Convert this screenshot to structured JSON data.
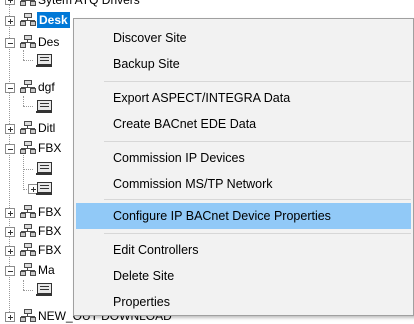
{
  "tree": {
    "nodes": [
      {
        "label": "Sytem ATQ Drivers"
      },
      {
        "label": "Desk",
        "selected": true
      },
      {
        "label": "Des"
      },
      {
        "label": "dgf"
      },
      {
        "label": "Ditl"
      },
      {
        "label": "FBX"
      },
      {
        "label": "FBX"
      },
      {
        "label": "FBX"
      },
      {
        "label": "FBX"
      },
      {
        "label": "Ma"
      },
      {
        "label": "NEW_OUT DOWNLOAD"
      }
    ]
  },
  "context_menu": {
    "highlighted_index": 6,
    "items": [
      {
        "label": "Discover Site"
      },
      {
        "label": "Backup Site"
      },
      {
        "label": "Export ASPECT/INTEGRA Data"
      },
      {
        "label": "Create BACnet EDE Data"
      },
      {
        "label": "Commission IP Devices"
      },
      {
        "label": "Commission MS/TP Network"
      },
      {
        "label": "Configure IP BACnet Device Properties"
      },
      {
        "label": "Edit Controllers"
      },
      {
        "label": "Delete Site"
      },
      {
        "label": "Properties"
      }
    ]
  },
  "colors": {
    "selection": "#0078d7",
    "menu_highlight": "#91c9f7",
    "menu_background": "#f2f2f2"
  },
  "icons": [
    "site-icon",
    "device-icon",
    "expand-icon",
    "collapse-icon"
  ]
}
